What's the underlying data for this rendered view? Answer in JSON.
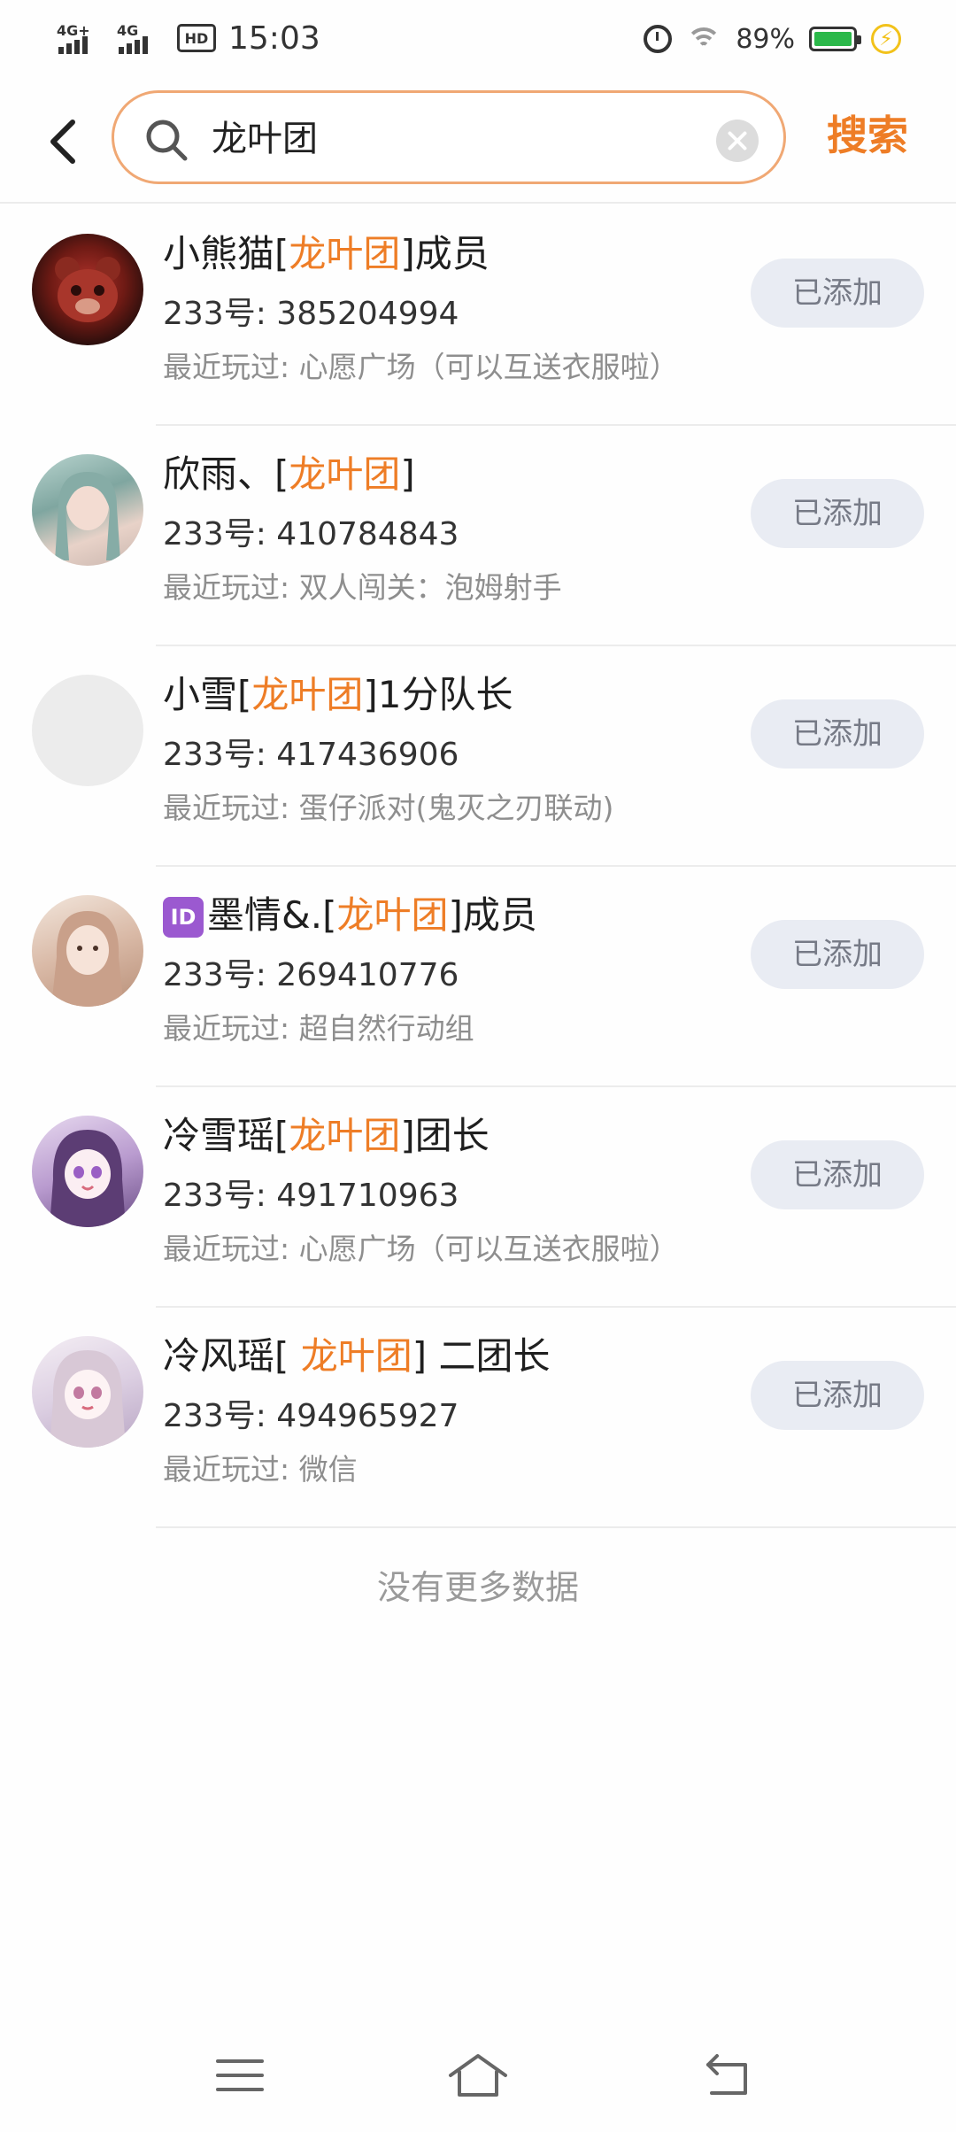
{
  "status_bar": {
    "network1": "4G+",
    "network2": "4G",
    "hd": "HD",
    "time": "15:03",
    "battery": "89%",
    "icons": [
      "signal-icon",
      "hd-icon",
      "alarm-icon",
      "wifi-icon",
      "battery-icon",
      "charging-icon"
    ]
  },
  "header": {
    "search_value": "龙叶团",
    "search_button": "搜索"
  },
  "results": [
    {
      "name_pre": "小熊猫[",
      "name_hl": "龙叶团",
      "name_post": "]成员",
      "badge": "",
      "uid": "233号: 385204994",
      "recent": "最近玩过: 心愿广场（可以互送衣服啦）",
      "button": "已添加"
    },
    {
      "name_pre": "欣雨、[",
      "name_hl": "龙叶团",
      "name_post": "]",
      "badge": "",
      "uid": "233号: 410784843",
      "recent": "最近玩过: 双人闯关：泡姆射手",
      "button": "已添加"
    },
    {
      "name_pre": "小雪[",
      "name_hl": "龙叶团",
      "name_post": "]1分队长",
      "badge": "",
      "uid": "233号: 417436906",
      "recent": "最近玩过: 蛋仔派对(鬼灭之刃联动)",
      "button": "已添加"
    },
    {
      "name_pre": "墨情&.[",
      "name_hl": "龙叶团",
      "name_post": "]成员",
      "badge": "ID",
      "uid": "233号: 269410776",
      "recent": "最近玩过: 超自然行动组",
      "button": "已添加"
    },
    {
      "name_pre": "冷雪瑶[",
      "name_hl": "龙叶团",
      "name_post": "]团长",
      "badge": "",
      "uid": "233号: 491710963",
      "recent": "最近玩过: 心愿广场（可以互送衣服啦）",
      "button": "已添加"
    },
    {
      "name_pre": "冷风瑶[ ",
      "name_hl": "龙叶团",
      "name_post": "] 二团长",
      "badge": "",
      "uid": "233号: 494965927",
      "recent": "最近玩过: 微信",
      "button": "已添加"
    }
  ],
  "footer": {
    "no_more": "没有更多数据"
  },
  "colors": {
    "accent": "#ee7d26",
    "search_border": "#f0a874",
    "added_bg": "#e9ecf3"
  },
  "navbar": {
    "icons": [
      "menu-icon",
      "home-icon",
      "back-nav-icon"
    ]
  }
}
